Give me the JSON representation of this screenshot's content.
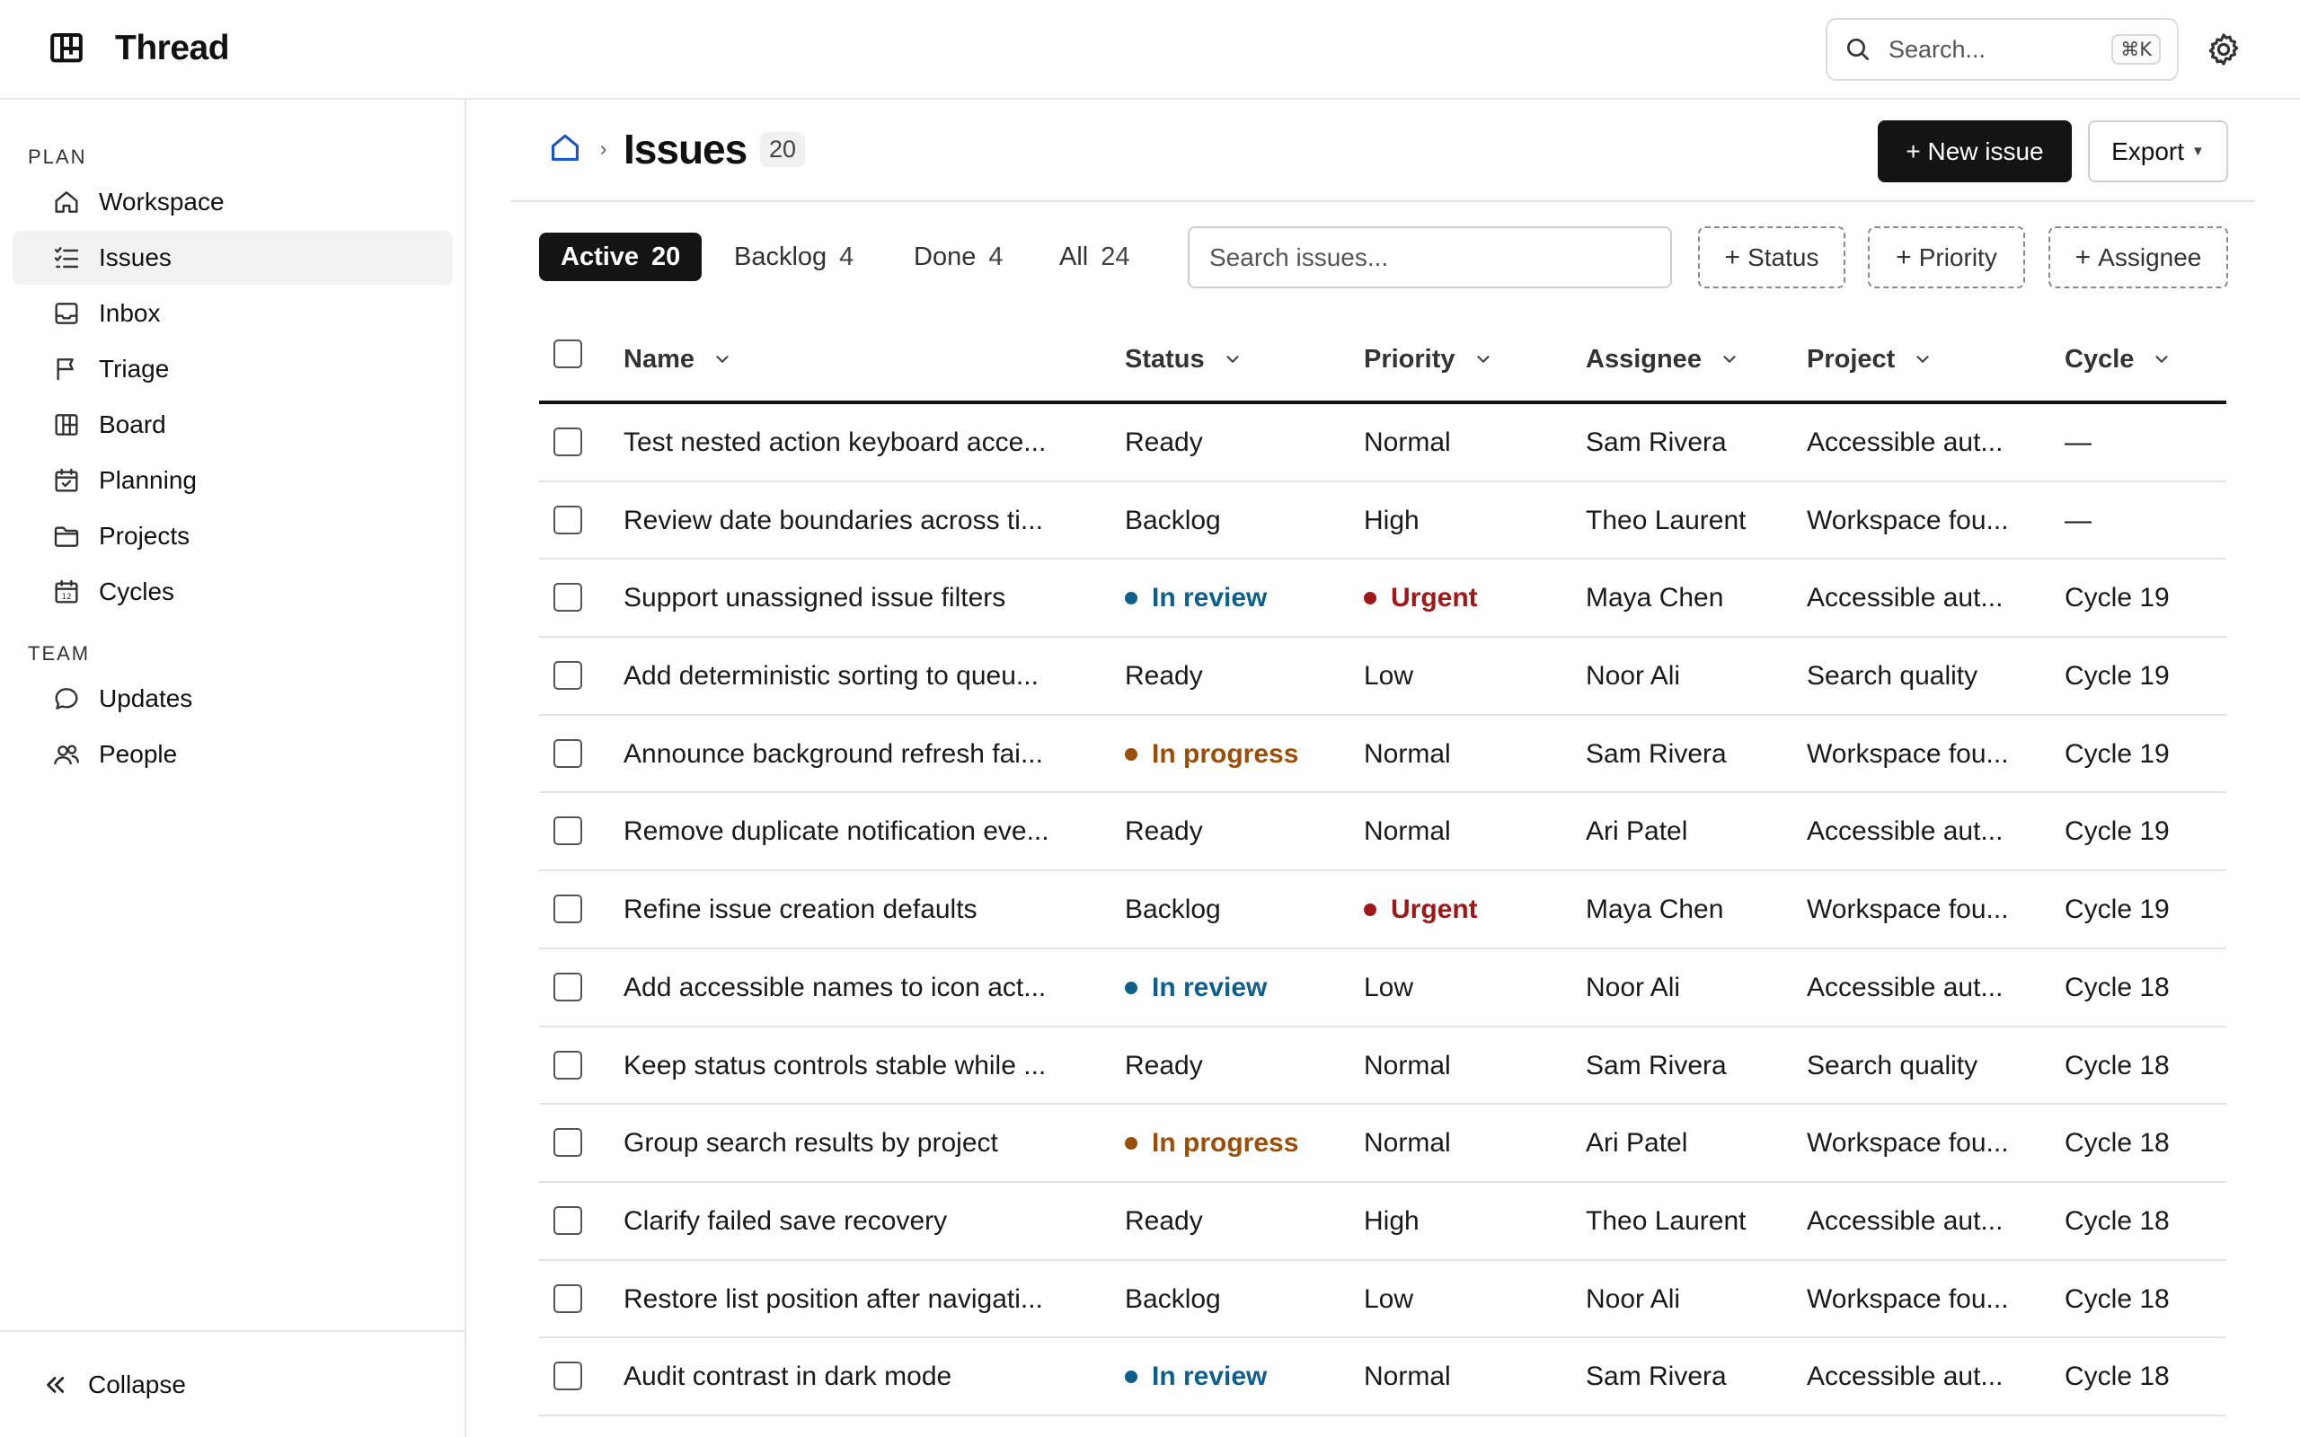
{
  "app": {
    "name": "Thread"
  },
  "topbar": {
    "search_placeholder": "Search...",
    "search_shortcut": "⌘K"
  },
  "sidebar": {
    "plan_label": "PLAN",
    "team_label": "TEAM",
    "plan_items": [
      {
        "label": "Workspace",
        "icon": "home-icon"
      },
      {
        "label": "Issues",
        "icon": "list-check-icon",
        "active": true
      },
      {
        "label": "Inbox",
        "icon": "inbox-icon"
      },
      {
        "label": "Triage",
        "icon": "flag-icon"
      },
      {
        "label": "Board",
        "icon": "board-icon"
      },
      {
        "label": "Planning",
        "icon": "calendar-check-icon"
      },
      {
        "label": "Projects",
        "icon": "folder-icon"
      },
      {
        "label": "Cycles",
        "icon": "calendar-icon"
      }
    ],
    "team_items": [
      {
        "label": "Updates",
        "icon": "chat-bubble-icon"
      },
      {
        "label": "People",
        "icon": "people-icon"
      }
    ],
    "collapse_label": "Collapse"
  },
  "header": {
    "title": "Issues",
    "count": "20",
    "new_issue_label": "+ New issue",
    "export_label": "Export"
  },
  "tabs": [
    {
      "label": "Active",
      "count": "20",
      "active": true
    },
    {
      "label": "Backlog",
      "count": "4"
    },
    {
      "label": "Done",
      "count": "4"
    },
    {
      "label": "All",
      "count": "24"
    }
  ],
  "filters": {
    "search_placeholder": "Search issues...",
    "chips": [
      "Status",
      "Priority",
      "Assignee"
    ]
  },
  "table": {
    "columns": [
      "Name",
      "Status",
      "Priority",
      "Assignee",
      "Project",
      "Cycle"
    ],
    "rows": [
      {
        "name": "Test nested action keyboard acce...",
        "status": "Ready",
        "priority": "Normal",
        "assignee": "Sam Rivera",
        "project": "Accessible aut...",
        "cycle": "—"
      },
      {
        "name": "Review date boundaries across ti...",
        "status": "Backlog",
        "priority": "High",
        "assignee": "Theo Laurent",
        "project": "Workspace fou...",
        "cycle": "—"
      },
      {
        "name": "Support unassigned issue filters",
        "status": "In review",
        "priority": "Urgent",
        "assignee": "Maya Chen",
        "project": "Accessible aut...",
        "cycle": "Cycle 19"
      },
      {
        "name": "Add deterministic sorting to queu...",
        "status": "Ready",
        "priority": "Low",
        "assignee": "Noor Ali",
        "project": "Search quality",
        "cycle": "Cycle 19"
      },
      {
        "name": "Announce background refresh fai...",
        "status": "In progress",
        "priority": "Normal",
        "assignee": "Sam Rivera",
        "project": "Workspace fou...",
        "cycle": "Cycle 19"
      },
      {
        "name": "Remove duplicate notification eve...",
        "status": "Ready",
        "priority": "Normal",
        "assignee": "Ari Patel",
        "project": "Accessible aut...",
        "cycle": "Cycle 19"
      },
      {
        "name": "Refine issue creation defaults",
        "status": "Backlog",
        "priority": "Urgent",
        "assignee": "Maya Chen",
        "project": "Workspace fou...",
        "cycle": "Cycle 19"
      },
      {
        "name": "Add accessible names to icon act...",
        "status": "In review",
        "priority": "Low",
        "assignee": "Noor Ali",
        "project": "Accessible aut...",
        "cycle": "Cycle 18"
      },
      {
        "name": "Keep status controls stable while ...",
        "status": "Ready",
        "priority": "Normal",
        "assignee": "Sam Rivera",
        "project": "Search quality",
        "cycle": "Cycle 18"
      },
      {
        "name": "Group search results by project",
        "status": "In progress",
        "priority": "Normal",
        "assignee": "Ari Patel",
        "project": "Workspace fou...",
        "cycle": "Cycle 18"
      },
      {
        "name": "Clarify failed save recovery",
        "status": "Ready",
        "priority": "High",
        "assignee": "Theo Laurent",
        "project": "Accessible aut...",
        "cycle": "Cycle 18"
      },
      {
        "name": "Restore list position after navigati...",
        "status": "Backlog",
        "priority": "Low",
        "assignee": "Noor Ali",
        "project": "Workspace fou...",
        "cycle": "Cycle 18"
      },
      {
        "name": "Audit contrast in dark mode",
        "status": "In review",
        "priority": "Normal",
        "assignee": "Sam Rivera",
        "project": "Accessible aut...",
        "cycle": "Cycle 18"
      }
    ]
  },
  "colors": {
    "primary": "#141414",
    "in_review": "#0f5f8c",
    "in_progress": "#9a4e07",
    "urgent": "#a11616",
    "breadcrumb_home": "#1a56c9"
  }
}
